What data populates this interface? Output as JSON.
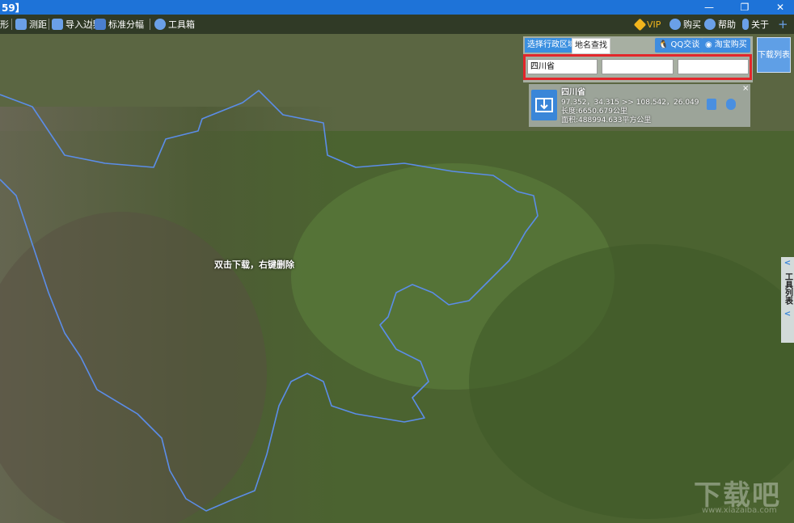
{
  "window": {
    "title": "59】",
    "minimize_glyph": "—",
    "restore_glyph": "❐",
    "close_glyph": "✕"
  },
  "toolbar": {
    "items": [
      {
        "label": "形",
        "icon": "polygon-icon"
      },
      {
        "label": "测距",
        "icon": "ruler-icon"
      },
      {
        "label": "导入边界",
        "icon": "import-icon"
      },
      {
        "label": "标准分幅",
        "icon": "grid-icon"
      },
      {
        "label": "工具箱",
        "icon": "gear-icon"
      }
    ],
    "right": [
      {
        "label": "VIP",
        "icon": "diamond-icon"
      },
      {
        "label": "购买",
        "icon": "cart-icon"
      },
      {
        "label": "帮助",
        "icon": "help-icon"
      },
      {
        "label": "关于",
        "icon": "info-icon"
      },
      {
        "label": "+",
        "icon": "plus-icon"
      }
    ]
  },
  "panel": {
    "tab_admin": "选择行政区域",
    "tab_place": "地名查找",
    "qq_label": "QQ交谈",
    "taobao_label": "淘宝购买",
    "select_province": "四川省",
    "select_city": "",
    "select_county": ""
  },
  "result": {
    "name": "四川省",
    "coords": "97.352，34.315 >> 108.542，26.049",
    "length": "长度:6650.679公里",
    "area": "面积:488994.633平方公里",
    "close_glyph": "×"
  },
  "download_list_label": "下载列表",
  "side_tab": {
    "arrow_top": "<",
    "label": "工具列表",
    "arrow_bottom": "<"
  },
  "map": {
    "hint": "双击下载，右键删除",
    "boundary_color": "#5b8de8"
  },
  "watermark": {
    "main": "下载吧",
    "sub": "www.xiazaiba.com"
  }
}
